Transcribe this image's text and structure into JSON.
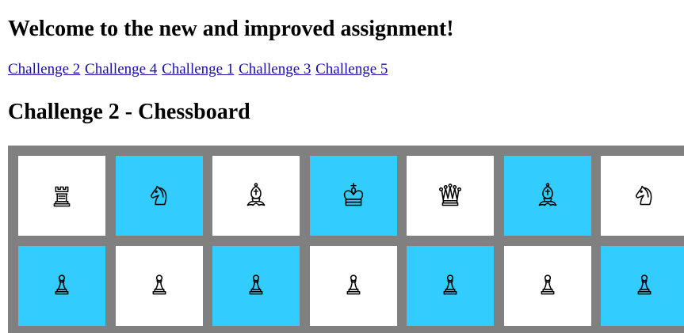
{
  "page": {
    "title": "Welcome to the new and improved assignment!"
  },
  "nav": {
    "links": [
      {
        "label": "Challenge 2"
      },
      {
        "label": "Challenge 4"
      },
      {
        "label": "Challenge 1"
      },
      {
        "label": "Challenge 3"
      },
      {
        "label": "Challenge 5"
      }
    ]
  },
  "section": {
    "title": "Challenge 2 - Chessboard"
  },
  "colors": {
    "light_square": "#ffffff",
    "dark_square": "#33ccff",
    "board_border": "#808080",
    "link": "#1a0dab"
  },
  "board": {
    "rows": [
      [
        {
          "piece": "rook-icon",
          "color": "light"
        },
        {
          "piece": "knight-icon",
          "color": "dark"
        },
        {
          "piece": "bishop-icon",
          "color": "light"
        },
        {
          "piece": "king-icon",
          "color": "dark"
        },
        {
          "piece": "queen-icon",
          "color": "light"
        },
        {
          "piece": "bishop-icon",
          "color": "dark"
        },
        {
          "piece": "knight-icon",
          "color": "light"
        }
      ],
      [
        {
          "piece": "pawn-icon",
          "color": "dark"
        },
        {
          "piece": "pawn-icon",
          "color": "light"
        },
        {
          "piece": "pawn-icon",
          "color": "dark"
        },
        {
          "piece": "pawn-icon",
          "color": "light"
        },
        {
          "piece": "pawn-icon",
          "color": "dark"
        },
        {
          "piece": "pawn-icon",
          "color": "light"
        },
        {
          "piece": "pawn-icon",
          "color": "dark"
        }
      ]
    ]
  }
}
